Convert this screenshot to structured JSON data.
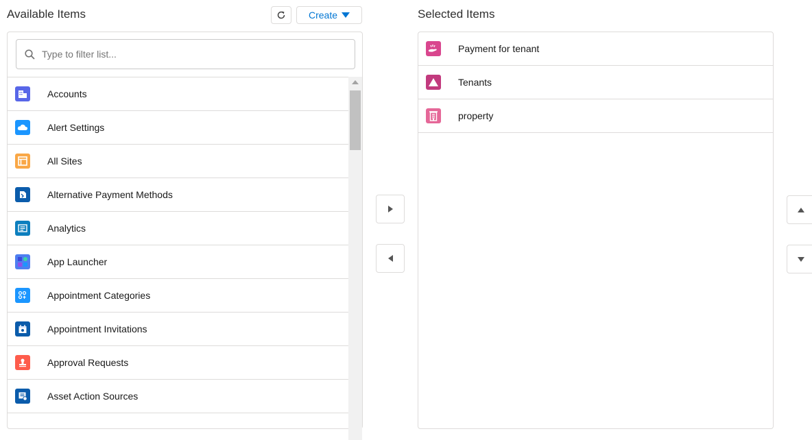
{
  "available": {
    "title": "Available Items",
    "create_label": "Create",
    "search_placeholder": "Type to filter list...",
    "items": [
      {
        "label": "Accounts",
        "color": "#5867e8",
        "icon": "accounts-icon"
      },
      {
        "label": "Alert Settings",
        "color": "#1b96ff",
        "icon": "cloud-icon"
      },
      {
        "label": "All Sites",
        "color": "#f9a746",
        "icon": "sites-icon"
      },
      {
        "label": "Alternative Payment Methods",
        "color": "#0b5cab",
        "icon": "payment-icon"
      },
      {
        "label": "Analytics",
        "color": "#0d7fbe",
        "icon": "analytics-icon"
      },
      {
        "label": "App Launcher",
        "color": "#4e7ff0",
        "icon": "app-launcher-icon"
      },
      {
        "label": "Appointment Categories",
        "color": "#1b96ff",
        "icon": "categories-icon"
      },
      {
        "label": "Appointment Invitations",
        "color": "#0b5cab",
        "icon": "calendar-icon"
      },
      {
        "label": "Approval Requests",
        "color": "#fe5c4c",
        "icon": "approval-icon"
      },
      {
        "label": "Asset Action Sources",
        "color": "#0b5cab",
        "icon": "asset-icon"
      }
    ]
  },
  "selected": {
    "title": "Selected Items",
    "items": [
      {
        "label": "Payment for tenant",
        "color": "#d9468e",
        "icon": "hand-icon"
      },
      {
        "label": "Tenants",
        "color": "#c23a7e",
        "icon": "triangle-icon"
      },
      {
        "label": "property",
        "color": "#e56798",
        "icon": "building-icon"
      }
    ]
  }
}
